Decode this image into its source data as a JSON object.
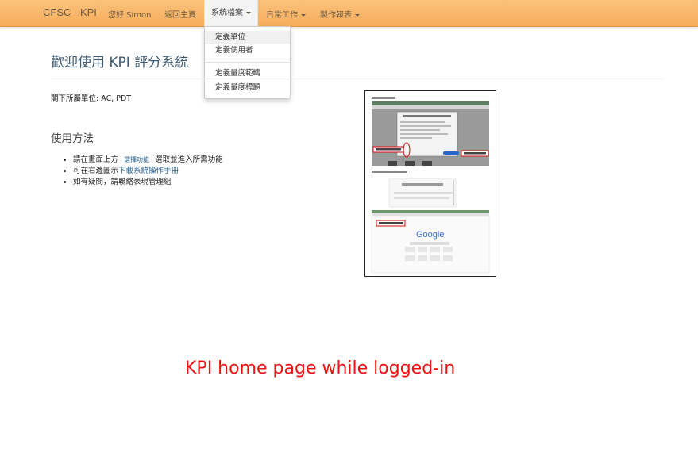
{
  "navbar": {
    "brand": "CFSC - KPI",
    "greeting": "您好 Simon",
    "back_home": "返回主頁",
    "menu_system": "系統檔案",
    "menu_daily": "日常工作",
    "menu_reports": "製作報表"
  },
  "dropdown": {
    "items": [
      "定義單位",
      "定義使用者",
      "定義量度範疇",
      "定義量度標題"
    ]
  },
  "page": {
    "title": "歡迎使用 KPI 評分系統",
    "unit_label": "閣下所屬單位:",
    "unit_value": "AC, PDT",
    "usage_title": "使用方法",
    "usage": {
      "item1_prefix": "請在畫面上方",
      "item1_link": "選擇功能",
      "item1_suffix": "選取並進入所需功能",
      "item2_prefix": "可在右邊圖示",
      "item2_link": "下載系統操作手冊",
      "item3": "如有疑問，請聯絡表現管理組"
    }
  },
  "screenshot_thumb": {
    "google_text": "Google"
  },
  "caption": "KPI home page while logged-in",
  "colors": {
    "navbar": "#f7ad5a",
    "link": "#2a6496",
    "caption": "#ee1111",
    "title": "#3d5a72"
  }
}
